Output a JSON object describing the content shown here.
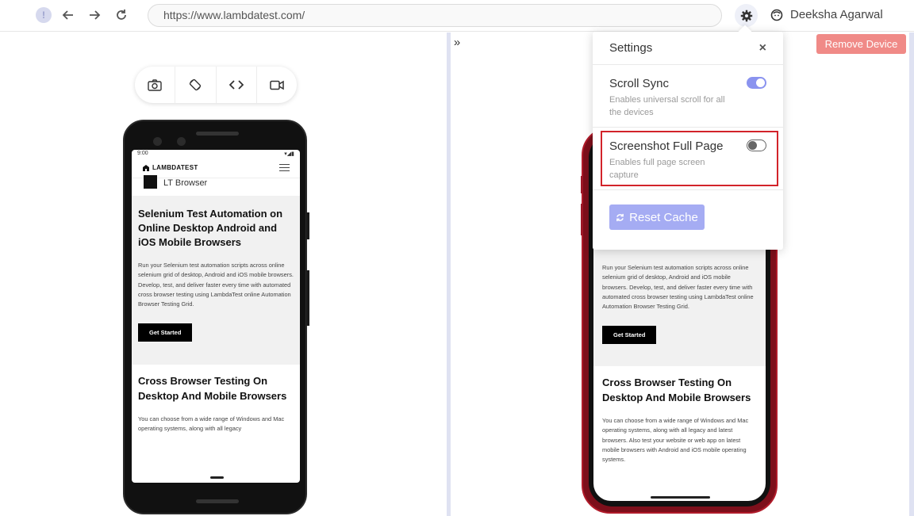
{
  "browser": {
    "url": "https://www.lambdatest.com/",
    "user_name": "Deeksha Agarwal"
  },
  "toolbar": {
    "collapse_glyph": "»",
    "remove_device_label": "Remove Device",
    "tools": [
      "camera-icon",
      "rotate-icon",
      "code-icon",
      "video-icon"
    ]
  },
  "left_device": {
    "status_time": "9:00",
    "logo_text": "LAMBDATEST",
    "nav_item": "LT Browser",
    "hero_title": "Selenium Test Automation on Online Desktop Android and iOS Mobile Browsers",
    "hero_text": "Run your Selenium test automation scripts across online selenium grid of desktop, Android and iOS mobile browsers. Develop, test, and deliver faster every time with automated cross browser testing using LambdaTest online Automation Browser Testing Grid.",
    "cta_label": "Get Started",
    "sec2_title": "Cross Browser Testing On Desktop And Mobile Browsers",
    "sec2_text": "You can choose from a wide range of Windows and Mac operating systems, along with all legacy"
  },
  "right_device": {
    "hero_text": "Run your Selenium test automation scripts across online selenium grid of desktop, Android and iOS mobile browsers. Develop, test, and deliver faster every time with automated cross browser testing using LambdaTest online Automation Browser Testing Grid.",
    "cta_label": "Get Started",
    "sec2_title": "Cross Browser Testing On Desktop And Mobile Browsers",
    "sec2_text": "You can choose from a wide range of Windows and Mac operating systems, along with all legacy and latest browsers. Also test your website or web app on latest mobile browsers with Android and iOS mobile operating systems."
  },
  "settings": {
    "title": "Settings",
    "close_glyph": "×",
    "scroll_sync": {
      "label": "Scroll Sync",
      "desc": "Enables universal scroll for all the devices",
      "enabled": true
    },
    "screenshot_full": {
      "label": "Screenshot Full Page",
      "desc": "Enables full page screen capture",
      "enabled": false
    },
    "reset_label": "Reset Cache"
  },
  "colors": {
    "accent": "#8a93ef",
    "remove_button": "#f08a87",
    "highlight": "#d2232a",
    "iphone_body": "#7d0f1b"
  }
}
